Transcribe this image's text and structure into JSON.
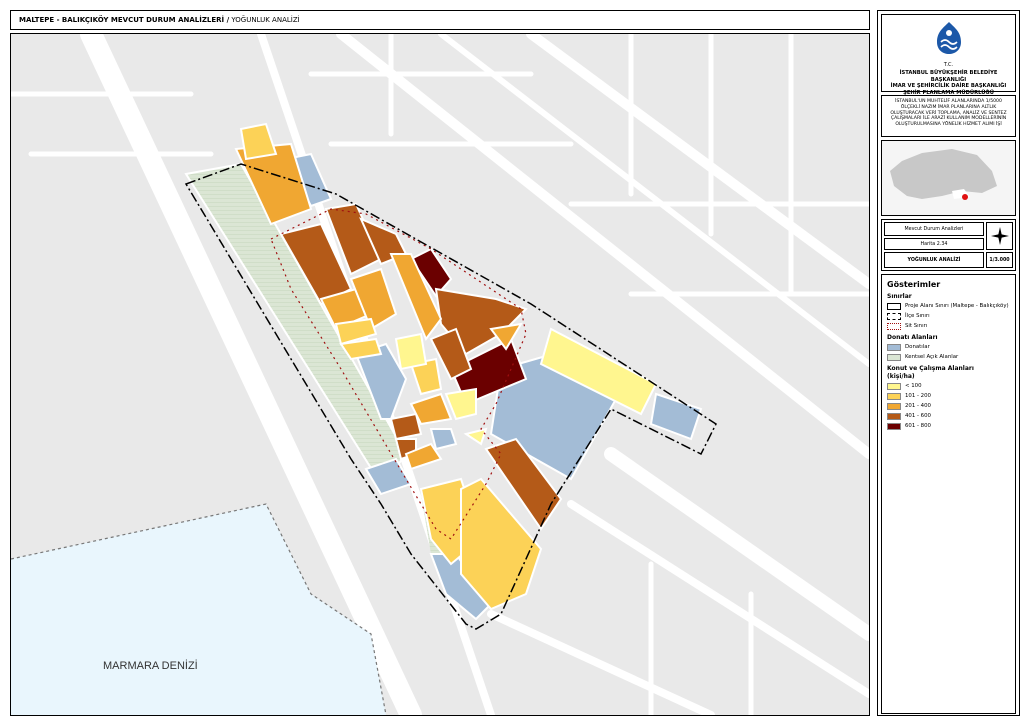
{
  "header": {
    "title": "MALTEPE - BALIKÇIKÖY MEVCUT DURUM ANALİZLERİ /",
    "subtitle": " YOĞUNLUK ANALİZİ"
  },
  "map": {
    "sea_label": "MARMARA DENİZİ"
  },
  "panel": {
    "logo_text": "T.C.",
    "org": [
      "İSTANBUL BÜYÜKŞEHİR BELEDİYE BAŞKANLIĞI",
      "İMAR VE ŞEHİRCİLİK DAİRE BAŞKANLIĞI",
      "ŞEHİR PLANLAMA MÜDÜRLÜĞÜ"
    ],
    "description": "İSTANBUL'UN MUHTELİF ALANLARINDA 1/5000 ÖLÇEKLİ NAZIM İMAR PLANLARINA ALTLIK OLUŞTURACAK VERİ TOPLAMA, ANALİZ VE SENTEZ ÇALIŞMALARI İLE ARAZİ KULLANIM MODELLERİNİN OLUŞTURULMASINA YÖNELİK HİZMET ALIMI İŞİ",
    "info": {
      "analysis_label": "Mevcut Durum Analizleri",
      "map_no": "Harita 2.34",
      "map_title": "YOĞUNLUK ANALİZİ",
      "scale": "1/3.000"
    }
  },
  "legend": {
    "title": "Gösterimler",
    "sections": [
      {
        "heading": "Sınırlar",
        "items": [
          {
            "label": "Proje Alanı Sınırı (Maltepe - Balıkçıköy)",
            "symbol": "project-boundary"
          },
          {
            "label": "İlçe Sınırı",
            "symbol": "district-boundary"
          },
          {
            "label": "Sit Sınırı",
            "symbol": "sit-boundary"
          }
        ]
      },
      {
        "heading": "Donatı Alanları",
        "items": [
          {
            "label": "Donatılar",
            "color": "#a3bcd6"
          },
          {
            "label": "Kentsel Açık Alanlar",
            "color": "#dbe6d4"
          }
        ]
      },
      {
        "heading": "Konut ve Çalışma  Alanları",
        "subheading": "(kişi/ha)",
        "items": [
          {
            "label": "< 100",
            "color": "#fff68f"
          },
          {
            "label": "101 - 200",
            "color": "#fcd257"
          },
          {
            "label": "201 - 400",
            "color": "#f0a732"
          },
          {
            "label": "401 - 600",
            "color": "#b45a18"
          },
          {
            "label": "601 - 800",
            "color": "#6b0000"
          }
        ]
      }
    ]
  },
  "colors": {
    "density_lt100": "#fff68f",
    "density_101_200": "#fcd257",
    "density_201_400": "#f0a732",
    "density_401_600": "#b45a18",
    "density_601_800": "#6b0000",
    "facilities": "#a3bcd6",
    "open_space": "#dbe6d4",
    "sea": "#e9f6fd",
    "background": "#e9e9e9"
  }
}
